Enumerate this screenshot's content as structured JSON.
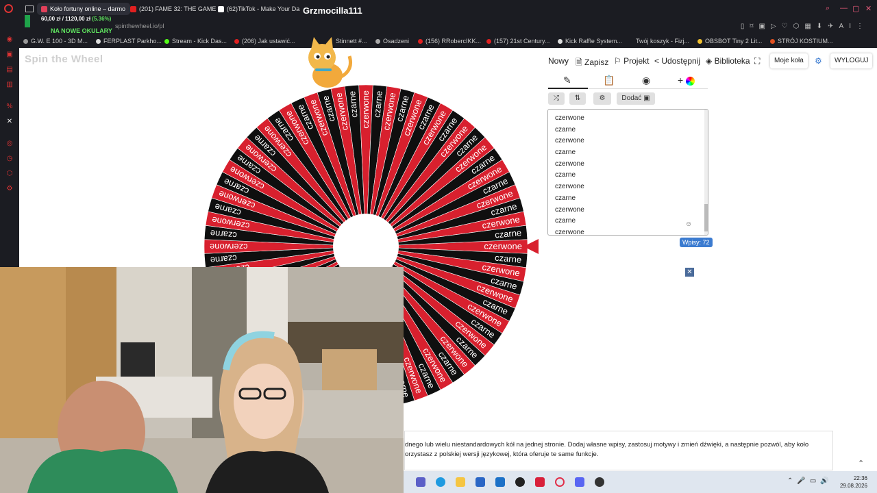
{
  "browser": {
    "tabs": [
      {
        "label": "Koło fortuny online – darmo",
        "active": true,
        "color": "#e0405a"
      },
      {
        "label": "(201) FAME 32: THE GAME",
        "active": false,
        "color": "#e02020"
      },
      {
        "label": "(62)TikTok - Make Your Da",
        "active": false,
        "color": "#ffffff"
      }
    ],
    "stream_title": "Grzmocilla111",
    "url": "spinthewheel.io/pl",
    "bookmarks": [
      {
        "label": "G.W. E 100 - 3D M...",
        "color": "#999"
      },
      {
        "label": "FERPLAST Parkho...",
        "color": "#ddd"
      },
      {
        "label": "Stream - Kick Das...",
        "color": "#53fc18"
      },
      {
        "label": "(206) Jak ustawić...",
        "color": "#e02020"
      },
      {
        "label": "Stinnett #...",
        "color": "#999"
      },
      {
        "label": "Osadzeni",
        "color": "#aaa"
      },
      {
        "label": "(156) RRobercIKK...",
        "color": "#e02020"
      },
      {
        "label": "(157) 21st Century...",
        "color": "#e02020"
      },
      {
        "label": "Kick Raffle System...",
        "color": "#ddd"
      },
      {
        "label": "Twój koszyk - Fizj...",
        "color": "#999"
      },
      {
        "label": "OBSBOT Tiny 2 Lit...",
        "color": "#f0c030"
      },
      {
        "label": "STRÓJ KOSTIUM...",
        "color": "#e05020"
      }
    ]
  },
  "overlay": {
    "donation": "60,00 zł / 1120,00 zł",
    "donation_pct": "(5.36%)",
    "goal": "NA NOWE OKULARY"
  },
  "app": {
    "logo": "Spin the Wheel",
    "menu": {
      "new": "Nowy",
      "save": "Zapisz",
      "project": "Projekt",
      "share": "Udostępnij",
      "library": "Biblioteka",
      "my_wheels": "Moje koła",
      "logout": "WYLOGUJ"
    },
    "add_button": "Dodać",
    "entries": [
      "czerwone",
      "czarne",
      "czerwone",
      "czarne",
      "czerwone",
      "czarne",
      "czerwone",
      "czarne",
      "czerwone",
      "czarne",
      "czerwone"
    ],
    "entry_count": "Wpisy: 72",
    "colors": {
      "red": "#d8202e",
      "black": "#0f0f0f",
      "accent": "#3b7bd0"
    }
  },
  "wheel": {
    "segments": 72,
    "labels": [
      "czerwone",
      "czarne"
    ],
    "colors": [
      "#d8202e",
      "#0f0f0f"
    ]
  },
  "description": {
    "line1": "dnego lub wielu niestandardowych kół na jednej stronie. Dodaj własne wpisy, zastosuj motywy i zmień dźwięki, a następnie pozwól, aby koło",
    "line2": "orzystasz z polskiej wersji językowej, która oferuje te same funkcje."
  },
  "taskbar": {
    "time": "22:36",
    "date": "29.08.2026"
  }
}
